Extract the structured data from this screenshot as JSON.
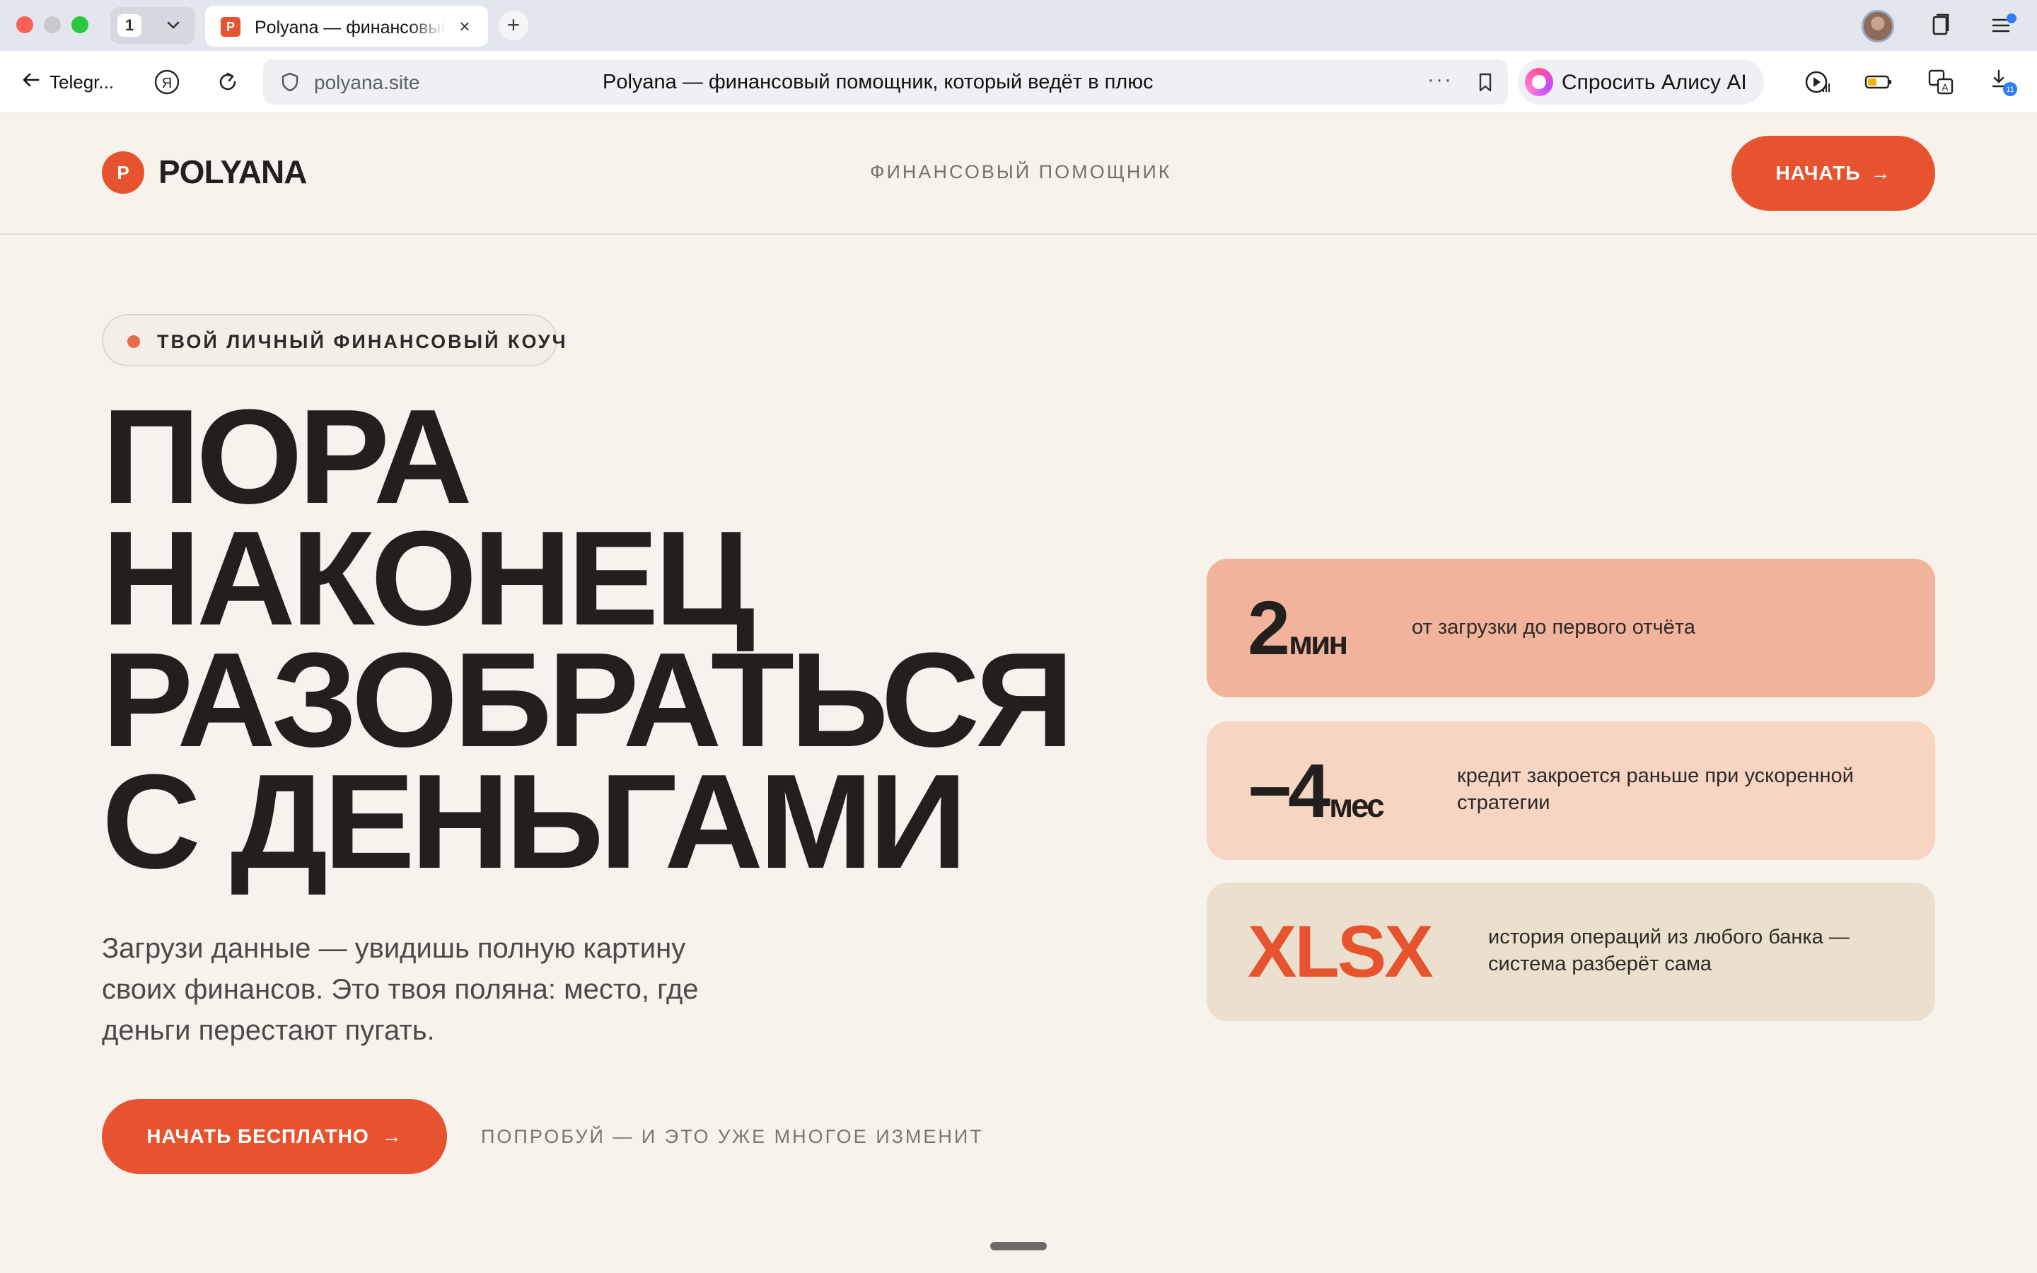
{
  "browser": {
    "tab_count": "1",
    "tab": {
      "favicon_letter": "P",
      "title": "Polyana — финансовый помощник"
    },
    "back_label": "Telegr...",
    "address": {
      "url": "polyana.site",
      "page_title": "Polyana — финансовый помощник, который ведёт в плюс"
    },
    "alice_label": "Спросить Алису AI",
    "downloads_badge": "11"
  },
  "header": {
    "logo_letter": "P",
    "logo_text": "POLYANA",
    "tagline": "ФИНАНСОВЫЙ ПОМОЩНИК",
    "cta_label": "НАЧАТЬ",
    "cta_arrow": "→"
  },
  "hero": {
    "pill_text": "ТВОЙ ЛИЧНЫЙ ФИНАНСОВЫЙ КОУЧ",
    "headline": [
      "ПОРА",
      "НАКОНЕЦ",
      "РАЗОБРАТЬСЯ",
      "С ДЕНЬГАМИ"
    ],
    "subtext": "Загрузи данные — увидишь полную картину своих финансов. Это твоя поляна: место, где деньги перестают пугать.",
    "cta_label": "НАЧАТЬ БЕСПЛАТНО",
    "cta_arrow": "→",
    "cta_note": "ПОПРОБУЙ — И ЭТО УЖЕ МНОГОЕ ИЗМЕНИТ"
  },
  "stats": [
    {
      "value": "2",
      "unit": "мин",
      "description": "от загрузки до первого отчёта",
      "color": "#f2b39d"
    },
    {
      "value": "−4",
      "unit": "мес",
      "description": "кредит закроется раньше при ускоренной стратегии",
      "color": "#f7d5c3"
    },
    {
      "value": "XLSX",
      "unit": "",
      "description": "история операций из любого банка — система разберёт сама",
      "color": "#ebdfcd"
    }
  ],
  "colors": {
    "accent": "#e8532f",
    "background": "#f7f3ec",
    "text": "#231f1c"
  },
  "icons": [
    "back-arrow-icon",
    "yandex-icon",
    "reload-icon",
    "shield-icon",
    "more-icon",
    "bookmark-icon",
    "alice-icon",
    "media-icon",
    "battery-icon",
    "translate-icon",
    "downloads-icon",
    "collections-icon",
    "menu-icon",
    "close-icon",
    "plus-icon",
    "chevron-down-icon",
    "arrow-right-icon"
  ]
}
